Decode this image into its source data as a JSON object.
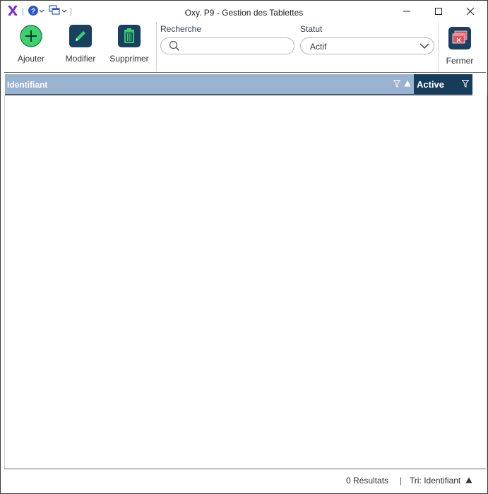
{
  "window": {
    "title": "Oxy. P9 - Gestion des Tablettes"
  },
  "toolbar": {
    "add_label": "Ajouter",
    "edit_label": "Modifier",
    "delete_label": "Supprimer",
    "close_label": "Fermer"
  },
  "search": {
    "label": "Recherche",
    "value": "",
    "placeholder": ""
  },
  "status_filter": {
    "label": "Statut",
    "selected": "Actif"
  },
  "grid": {
    "columns": [
      "Identifiant",
      "Active"
    ],
    "rows": []
  },
  "statusbar": {
    "results": "0 Résultats",
    "separator": "|",
    "sort": "Tri: Identifiant"
  },
  "colors": {
    "header_light": "#9ab3d0",
    "header_dark": "#163c5b",
    "add_green": "#3ad26e",
    "button_dark": "#17415f",
    "close_red": "#e05564",
    "app_purple": "#7a2bd6"
  },
  "icons": {
    "app": "app-logo-icon",
    "help": "help-icon",
    "windows": "windows-icon",
    "add": "plus-icon",
    "edit": "pencil-icon",
    "delete": "trash-icon",
    "close": "close-window-icon",
    "search": "search-icon",
    "dropdown": "chevron-down-icon",
    "filter": "filter-icon",
    "sort": "sort-up-icon"
  }
}
